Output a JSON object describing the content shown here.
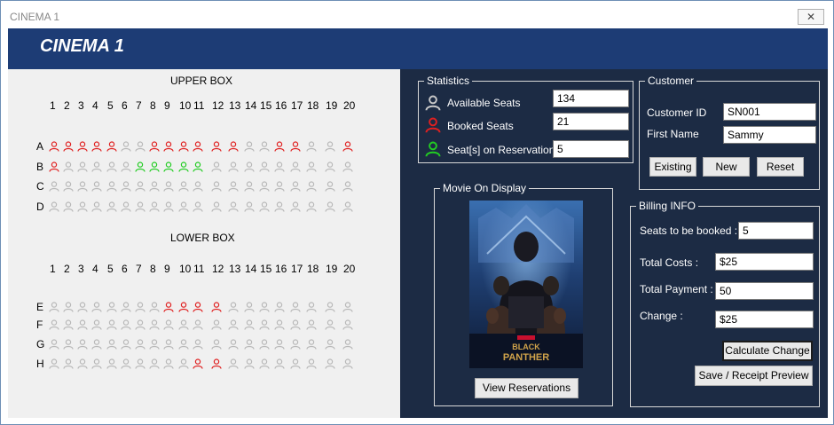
{
  "window": {
    "title": "CINEMA 1",
    "close_glyph": "✕"
  },
  "header": {
    "title": "CINEMA 1"
  },
  "upper_box": {
    "title": "UPPER BOX",
    "rows": [
      {
        "label": "A",
        "seats": "BBBBBAABBBBBBAABBAAB"
      },
      {
        "label": "B",
        "seats": "BAAAAARRRRRAAAAAAAAA"
      },
      {
        "label": "C",
        "seats": "AAAAAAAAAAAAAAAAAAAA"
      },
      {
        "label": "D",
        "seats": "AAAAAAAAAAAAAAAAAAAA"
      }
    ]
  },
  "lower_box": {
    "title": "LOWER BOX",
    "rows": [
      {
        "label": "E",
        "seats": "AAAAAAAABBBBAAAAAAAA"
      },
      {
        "label": "F",
        "seats": "AAAAAAAAAAAAAAAAAAAA"
      },
      {
        "label": "G",
        "seats": "AAAAAAAAAAAAAAAAAAAA"
      },
      {
        "label": "H",
        "seats": "AAAAAAAAAABBAAAAAAAA"
      }
    ]
  },
  "columns": [
    "1",
    "2",
    "3",
    "4",
    "5",
    "6",
    "7",
    "8",
    "9",
    "10",
    "11",
    "12",
    "13",
    "14",
    "15",
    "16",
    "17",
    "18",
    "19",
    "20"
  ],
  "seat_colors": {
    "A": "#b8b8b8",
    "B": "#e02020",
    "R": "#22cc22"
  },
  "statistics": {
    "legend": "Statistics",
    "available_label": "Available Seats",
    "available_value": "134",
    "booked_label": "Booked Seats",
    "booked_value": "21",
    "reservation_label": "Seat[s] on Reservation",
    "reservation_value": "5",
    "icon_colors": {
      "available": "#c8c8c8",
      "booked": "#e02020",
      "reservation": "#22cc22"
    }
  },
  "customer": {
    "legend": "Customer",
    "id_label": "Customer ID",
    "id_value": "SN001",
    "name_label": "First Name",
    "name_value": "Sammy",
    "existing_btn": "Existing",
    "new_btn": "New",
    "reset_btn": "Reset"
  },
  "movie": {
    "legend": "Movie On Display",
    "poster_title_line1": "BLACK",
    "poster_title_line2": "PANTHER",
    "view_btn": "View Reservations"
  },
  "billing": {
    "legend": "Billing INFO",
    "seats_label": "Seats to be booked :",
    "seats_value": "5",
    "costs_label": "Total Costs :",
    "costs_value": "$25",
    "payment_label": "Total Payment :",
    "payment_value": "50",
    "change_label": "Change :",
    "change_value": "$25",
    "calc_btn": "Calculate Change",
    "save_btn": "Save / Receipt Preview"
  }
}
